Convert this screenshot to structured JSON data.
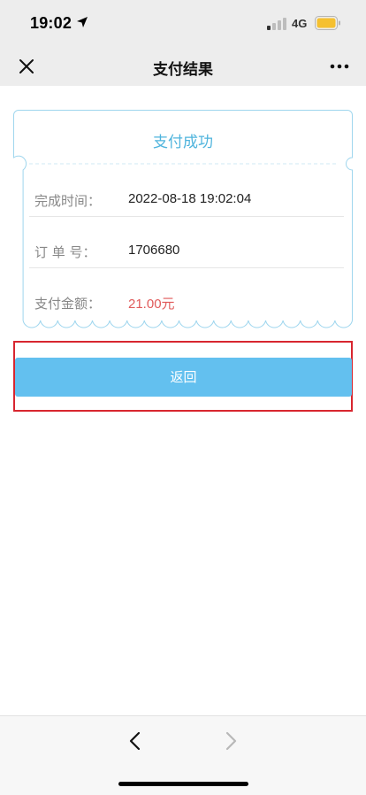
{
  "status_bar": {
    "time": "19:02",
    "network": "4G",
    "location_icon": "location-arrow-icon",
    "signal_icon": "cellular-signal-icon",
    "battery_icon": "battery-icon",
    "battery_color": "#f5c030"
  },
  "nav": {
    "title": "支付结果",
    "close_icon": "close-icon",
    "more_icon": "more-dots-icon"
  },
  "card": {
    "title": "支付成功",
    "accent_color": "#4fb4dd",
    "rows": [
      {
        "label": "完成时间：",
        "value": "2022-08-18 19:02:04"
      },
      {
        "label": "订 单 号：",
        "value": "1706680"
      },
      {
        "label": "支付金额：",
        "value": "21.00元"
      }
    ]
  },
  "return_button": {
    "label": "返回",
    "color": "#63c0ef",
    "highlight_color": "#d8262f"
  },
  "bottom_bar": {
    "back_icon": "chevron-left-icon",
    "forward_icon": "chevron-right-icon"
  }
}
